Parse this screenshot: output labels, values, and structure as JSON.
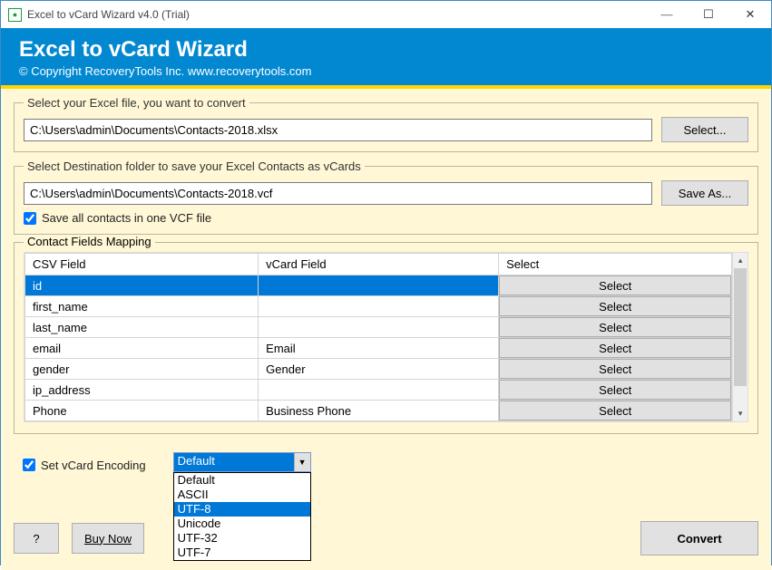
{
  "window": {
    "title": "Excel to vCard Wizard v4.0 (Trial)"
  },
  "header": {
    "title": "Excel to vCard Wizard",
    "copyright": "© Copyright RecoveryTools Inc. www.recoverytools.com"
  },
  "source": {
    "legend": "Select your Excel file, you want to convert",
    "path": "C:\\Users\\admin\\Documents\\Contacts-2018.xlsx",
    "button": "Select..."
  },
  "dest": {
    "legend": "Select Destination folder to save your Excel Contacts as vCards",
    "path": "C:\\Users\\admin\\Documents\\Contacts-2018.vcf",
    "button": "Save As...",
    "checkbox": "Save all contacts in one VCF file",
    "checked": true
  },
  "mapping": {
    "legend": "Contact Fields Mapping",
    "headers": {
      "csv": "CSV Field",
      "vcard": "vCard Field",
      "select": "Select"
    },
    "select_label": "Select",
    "rows": [
      {
        "csv": "id",
        "vcard": "",
        "selected": true
      },
      {
        "csv": "first_name",
        "vcard": ""
      },
      {
        "csv": "last_name",
        "vcard": ""
      },
      {
        "csv": "email",
        "vcard": "Email"
      },
      {
        "csv": "gender",
        "vcard": "Gender"
      },
      {
        "csv": "ip_address",
        "vcard": ""
      },
      {
        "csv": "Phone",
        "vcard": "Business Phone"
      }
    ]
  },
  "encoding": {
    "label": "Set vCard Encoding",
    "checked": true,
    "selected": "Default",
    "options": [
      "Default",
      "ASCII",
      "UTF-8",
      "Unicode",
      "UTF-32",
      "UTF-7"
    ],
    "highlighted": "UTF-8"
  },
  "footer": {
    "help": "?",
    "buy": "Buy Now",
    "convert": "Convert"
  }
}
